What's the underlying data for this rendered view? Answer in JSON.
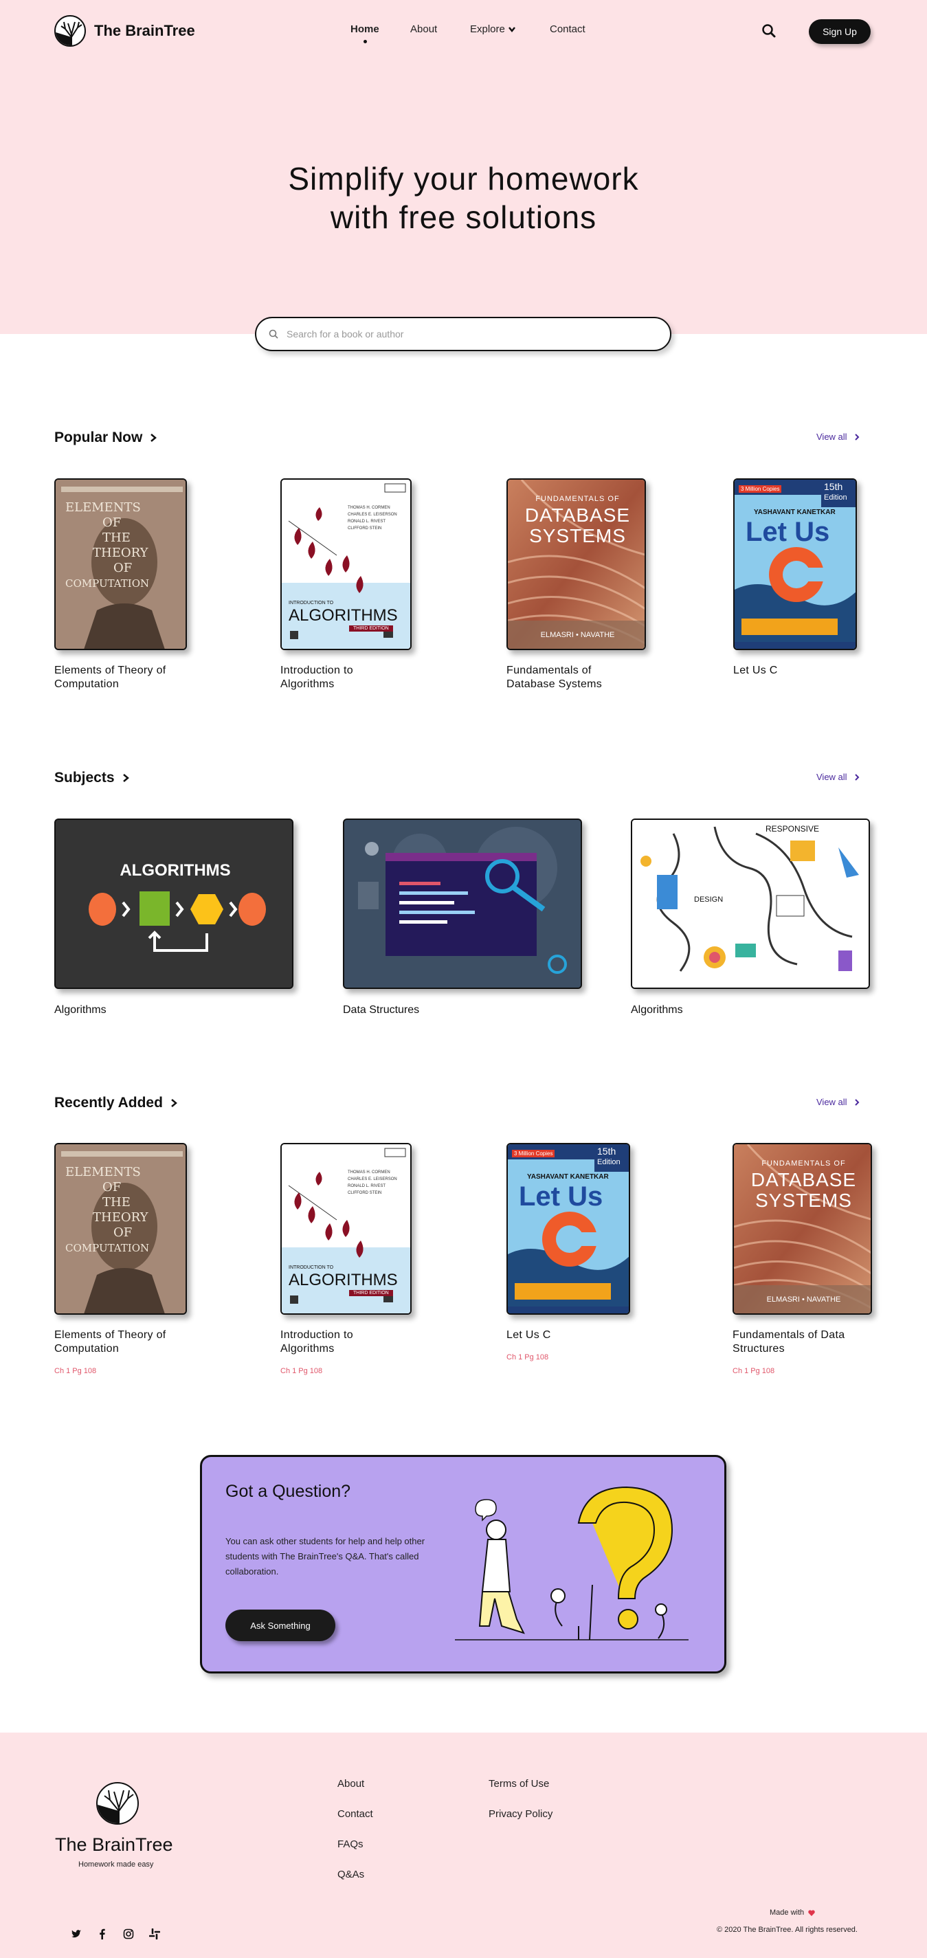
{
  "brand": {
    "name": "The BrainTree",
    "tagline": "Homework made easy"
  },
  "nav": {
    "items": [
      {
        "label": "Home",
        "active": true
      },
      {
        "label": "About"
      },
      {
        "label": "Explore"
      },
      {
        "label": "Contact"
      }
    ],
    "signup_label": "Sign Up"
  },
  "hero": {
    "title_line1": "Simplify your homework",
    "title_line2": "with free solutions",
    "search_placeholder": "Search for a book or author"
  },
  "popular": {
    "heading": "Popular Now",
    "view_all": "View all",
    "books": [
      {
        "title_l1": "Elements of Theory of",
        "title_l2": "Computation"
      },
      {
        "title_l1": "Introduction to",
        "title_l2": "Algorithms"
      },
      {
        "title_l1": "Fundamentals of",
        "title_l2": "Database Systems"
      },
      {
        "title_l1": "Let Us C",
        "title_l2": ""
      }
    ]
  },
  "subjects": {
    "heading": "Subjects",
    "view_all": "View all",
    "items": [
      {
        "title": "Algorithms",
        "cover_text": "ALGORITHMS"
      },
      {
        "title": "Data Structures"
      },
      {
        "title": "Algorithms",
        "cover_text": "RESPONSIVE",
        "cover_text2": "DESIGN"
      }
    ]
  },
  "recent": {
    "heading": "Recently Added",
    "view_all": "View all",
    "books": [
      {
        "title_l1": "Elements of Theory of",
        "title_l2": "Computation",
        "meta": "Ch 1 Pg 108"
      },
      {
        "title_l1": "Introduction to",
        "title_l2": "Algorithms",
        "meta": "Ch 1 Pg 108"
      },
      {
        "title_l1": "Let Us C",
        "title_l2": "",
        "meta": "Ch 1 Pg 108"
      },
      {
        "title_l1": "Fundamentals of Data",
        "title_l2": "Structures",
        "meta": "Ch 1 Pg 108"
      }
    ]
  },
  "covers": {
    "toc": {
      "line1": "ELEMENTS",
      "line2": "OF",
      "line3": "THE",
      "line4": "THEORY",
      "line5": "OF",
      "line6": "COMPUTATION"
    },
    "clrs": {
      "title": "ALGORITHMS",
      "prefix": "INTRODUCTION TO",
      "edition": "THIRD EDITION"
    },
    "db": {
      "line1": "FUNDAMENTALS OF",
      "line2": "DATABASE",
      "line3": "SYSTEMS",
      "authors": "ELMASRI • NAVATHE"
    },
    "letusc": {
      "title": "Let Us",
      "letter": "C",
      "edition": "15th",
      "edition2": "Edition",
      "author": "YASHAVANT KANETKAR",
      "sold": "3 Million Copies"
    }
  },
  "question": {
    "title": "Got a Question?",
    "text": "You can ask other students for help and help other students with The BrainTree's Q&A. That's called collaboration.",
    "button": "Ask Something"
  },
  "footer": {
    "col1": [
      "About",
      "Contact",
      "FAQs",
      "Q&As"
    ],
    "col2": [
      "Terms of Use",
      "Privacy Policy"
    ],
    "made_with": "Made with",
    "copyright": "© 2020 The BrainTree. All rights reserved."
  },
  "colors": {
    "hero_bg": "#fde3e6",
    "accent": "#4b2a9e",
    "card_bg": "#b8a2ef",
    "meta": "#e0566a"
  }
}
